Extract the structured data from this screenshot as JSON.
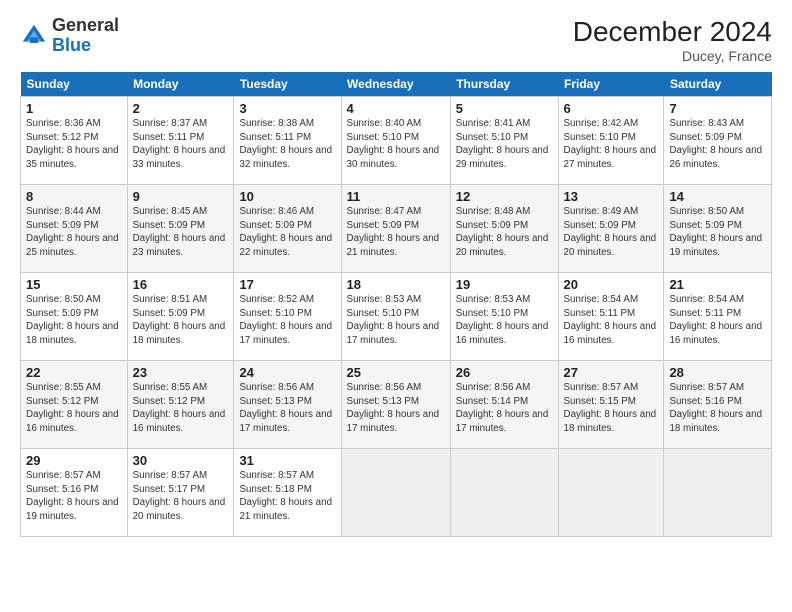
{
  "logo": {
    "general": "General",
    "blue": "Blue"
  },
  "title": "December 2024",
  "location": "Ducey, France",
  "days_header": [
    "Sunday",
    "Monday",
    "Tuesday",
    "Wednesday",
    "Thursday",
    "Friday",
    "Saturday"
  ],
  "weeks": [
    [
      {
        "day": "1",
        "sunrise": "Sunrise: 8:36 AM",
        "sunset": "Sunset: 5:12 PM",
        "daylight": "Daylight: 8 hours and 35 minutes."
      },
      {
        "day": "2",
        "sunrise": "Sunrise: 8:37 AM",
        "sunset": "Sunset: 5:11 PM",
        "daylight": "Daylight: 8 hours and 33 minutes."
      },
      {
        "day": "3",
        "sunrise": "Sunrise: 8:38 AM",
        "sunset": "Sunset: 5:11 PM",
        "daylight": "Daylight: 8 hours and 32 minutes."
      },
      {
        "day": "4",
        "sunrise": "Sunrise: 8:40 AM",
        "sunset": "Sunset: 5:10 PM",
        "daylight": "Daylight: 8 hours and 30 minutes."
      },
      {
        "day": "5",
        "sunrise": "Sunrise: 8:41 AM",
        "sunset": "Sunset: 5:10 PM",
        "daylight": "Daylight: 8 hours and 29 minutes."
      },
      {
        "day": "6",
        "sunrise": "Sunrise: 8:42 AM",
        "sunset": "Sunset: 5:10 PM",
        "daylight": "Daylight: 8 hours and 27 minutes."
      },
      {
        "day": "7",
        "sunrise": "Sunrise: 8:43 AM",
        "sunset": "Sunset: 5:09 PM",
        "daylight": "Daylight: 8 hours and 26 minutes."
      }
    ],
    [
      {
        "day": "8",
        "sunrise": "Sunrise: 8:44 AM",
        "sunset": "Sunset: 5:09 PM",
        "daylight": "Daylight: 8 hours and 25 minutes."
      },
      {
        "day": "9",
        "sunrise": "Sunrise: 8:45 AM",
        "sunset": "Sunset: 5:09 PM",
        "daylight": "Daylight: 8 hours and 23 minutes."
      },
      {
        "day": "10",
        "sunrise": "Sunrise: 8:46 AM",
        "sunset": "Sunset: 5:09 PM",
        "daylight": "Daylight: 8 hours and 22 minutes."
      },
      {
        "day": "11",
        "sunrise": "Sunrise: 8:47 AM",
        "sunset": "Sunset: 5:09 PM",
        "daylight": "Daylight: 8 hours and 21 minutes."
      },
      {
        "day": "12",
        "sunrise": "Sunrise: 8:48 AM",
        "sunset": "Sunset: 5:09 PM",
        "daylight": "Daylight: 8 hours and 20 minutes."
      },
      {
        "day": "13",
        "sunrise": "Sunrise: 8:49 AM",
        "sunset": "Sunset: 5:09 PM",
        "daylight": "Daylight: 8 hours and 20 minutes."
      },
      {
        "day": "14",
        "sunrise": "Sunrise: 8:50 AM",
        "sunset": "Sunset: 5:09 PM",
        "daylight": "Daylight: 8 hours and 19 minutes."
      }
    ],
    [
      {
        "day": "15",
        "sunrise": "Sunrise: 8:50 AM",
        "sunset": "Sunset: 5:09 PM",
        "daylight": "Daylight: 8 hours and 18 minutes."
      },
      {
        "day": "16",
        "sunrise": "Sunrise: 8:51 AM",
        "sunset": "Sunset: 5:09 PM",
        "daylight": "Daylight: 8 hours and 18 minutes."
      },
      {
        "day": "17",
        "sunrise": "Sunrise: 8:52 AM",
        "sunset": "Sunset: 5:10 PM",
        "daylight": "Daylight: 8 hours and 17 minutes."
      },
      {
        "day": "18",
        "sunrise": "Sunrise: 8:53 AM",
        "sunset": "Sunset: 5:10 PM",
        "daylight": "Daylight: 8 hours and 17 minutes."
      },
      {
        "day": "19",
        "sunrise": "Sunrise: 8:53 AM",
        "sunset": "Sunset: 5:10 PM",
        "daylight": "Daylight: 8 hours and 16 minutes."
      },
      {
        "day": "20",
        "sunrise": "Sunrise: 8:54 AM",
        "sunset": "Sunset: 5:11 PM",
        "daylight": "Daylight: 8 hours and 16 minutes."
      },
      {
        "day": "21",
        "sunrise": "Sunrise: 8:54 AM",
        "sunset": "Sunset: 5:11 PM",
        "daylight": "Daylight: 8 hours and 16 minutes."
      }
    ],
    [
      {
        "day": "22",
        "sunrise": "Sunrise: 8:55 AM",
        "sunset": "Sunset: 5:12 PM",
        "daylight": "Daylight: 8 hours and 16 minutes."
      },
      {
        "day": "23",
        "sunrise": "Sunrise: 8:55 AM",
        "sunset": "Sunset: 5:12 PM",
        "daylight": "Daylight: 8 hours and 16 minutes."
      },
      {
        "day": "24",
        "sunrise": "Sunrise: 8:56 AM",
        "sunset": "Sunset: 5:13 PM",
        "daylight": "Daylight: 8 hours and 17 minutes."
      },
      {
        "day": "25",
        "sunrise": "Sunrise: 8:56 AM",
        "sunset": "Sunset: 5:13 PM",
        "daylight": "Daylight: 8 hours and 17 minutes."
      },
      {
        "day": "26",
        "sunrise": "Sunrise: 8:56 AM",
        "sunset": "Sunset: 5:14 PM",
        "daylight": "Daylight: 8 hours and 17 minutes."
      },
      {
        "day": "27",
        "sunrise": "Sunrise: 8:57 AM",
        "sunset": "Sunset: 5:15 PM",
        "daylight": "Daylight: 8 hours and 18 minutes."
      },
      {
        "day": "28",
        "sunrise": "Sunrise: 8:57 AM",
        "sunset": "Sunset: 5:16 PM",
        "daylight": "Daylight: 8 hours and 18 minutes."
      }
    ],
    [
      {
        "day": "29",
        "sunrise": "Sunrise: 8:57 AM",
        "sunset": "Sunset: 5:16 PM",
        "daylight": "Daylight: 8 hours and 19 minutes."
      },
      {
        "day": "30",
        "sunrise": "Sunrise: 8:57 AM",
        "sunset": "Sunset: 5:17 PM",
        "daylight": "Daylight: 8 hours and 20 minutes."
      },
      {
        "day": "31",
        "sunrise": "Sunrise: 8:57 AM",
        "sunset": "Sunset: 5:18 PM",
        "daylight": "Daylight: 8 hours and 21 minutes."
      },
      null,
      null,
      null,
      null
    ]
  ]
}
